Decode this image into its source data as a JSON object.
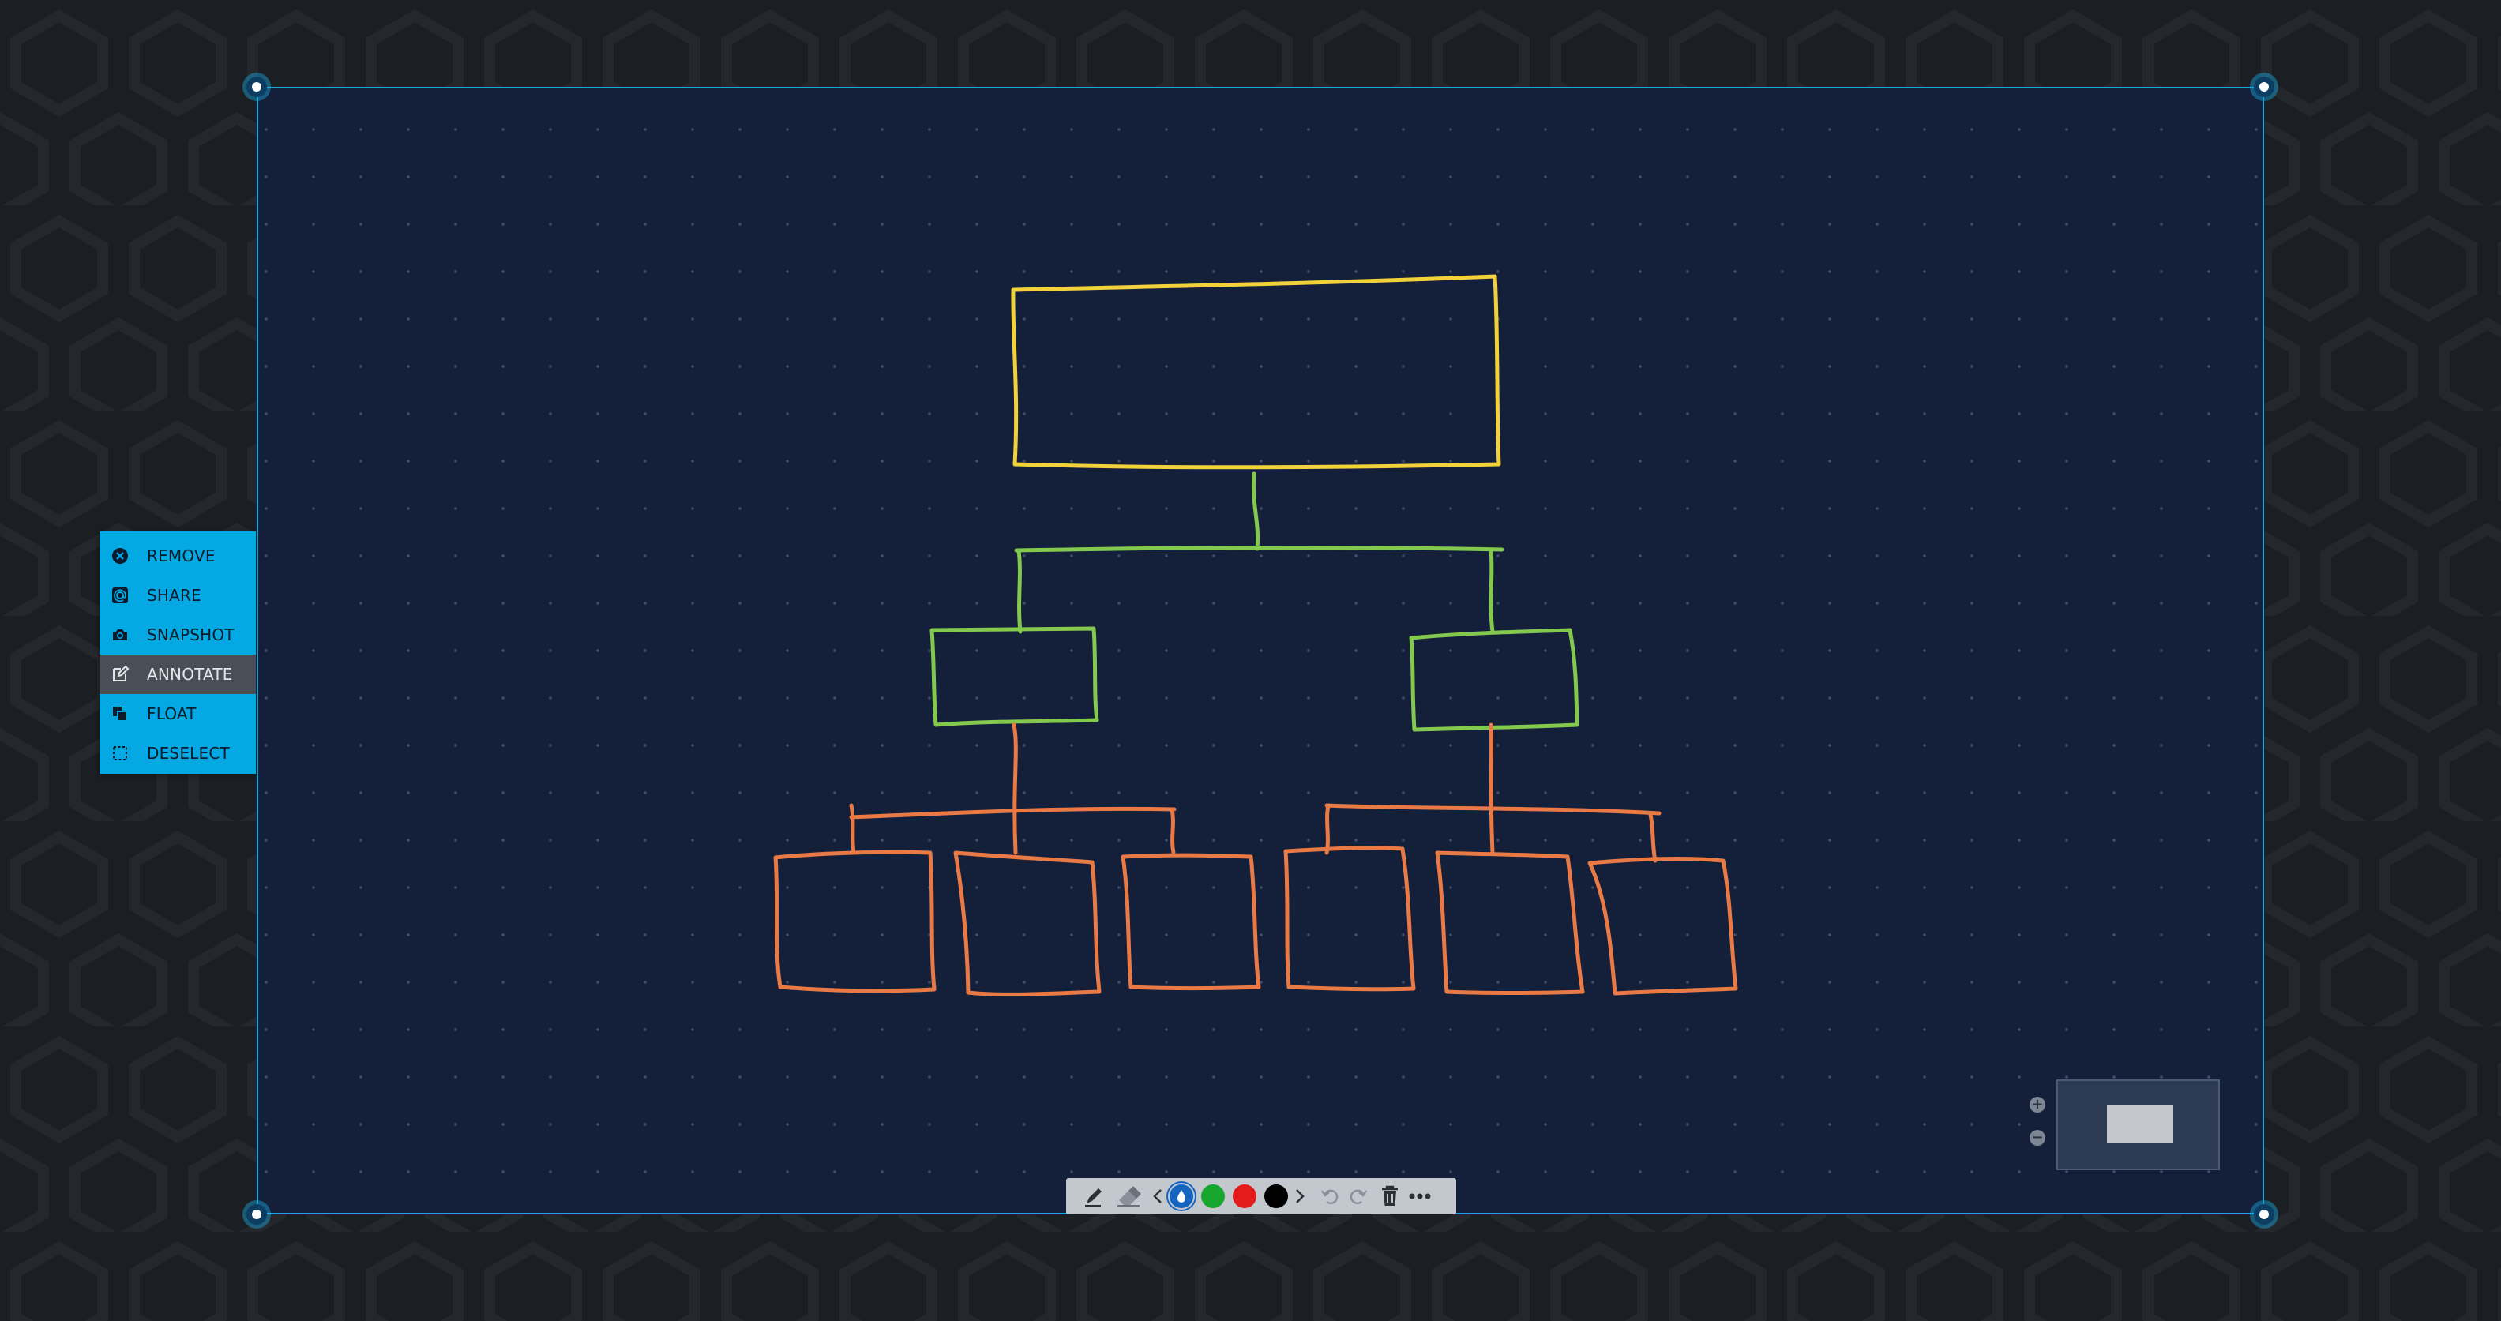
{
  "context_menu": {
    "items": [
      {
        "label": "REMOVE",
        "icon": "remove-circle-icon",
        "active": false
      },
      {
        "label": "SHARE",
        "icon": "share-at-icon",
        "active": false
      },
      {
        "label": "SNAPSHOT",
        "icon": "camera-icon",
        "active": false
      },
      {
        "label": "ANNOTATE",
        "icon": "edit-icon",
        "active": true
      },
      {
        "label": "FLOAT",
        "icon": "float-layers-icon",
        "active": false
      },
      {
        "label": "DESELECT",
        "icon": "dashed-square-icon",
        "active": false
      }
    ]
  },
  "toolbar": {
    "tools": [
      "pen-icon",
      "eraser-icon",
      "chevron-left-icon",
      "chevron-right-icon",
      "undo-icon",
      "redo-icon",
      "trash-icon",
      "more-icon"
    ],
    "colors": [
      "#1565c0",
      "#17a62e",
      "#e31b1b",
      "#000000"
    ],
    "selected_color": "#1565c0"
  },
  "minimap": {
    "zoom_in": "+",
    "zoom_out": "−"
  },
  "colors": {
    "canvas_bg": "#141f3a",
    "frame_border": "#1aa7de",
    "menu_bg": "#04a9e3",
    "level1_stroke": "#f2d13a",
    "level2_stroke": "#82c94e",
    "level3_stroke": "#ea7a45"
  }
}
